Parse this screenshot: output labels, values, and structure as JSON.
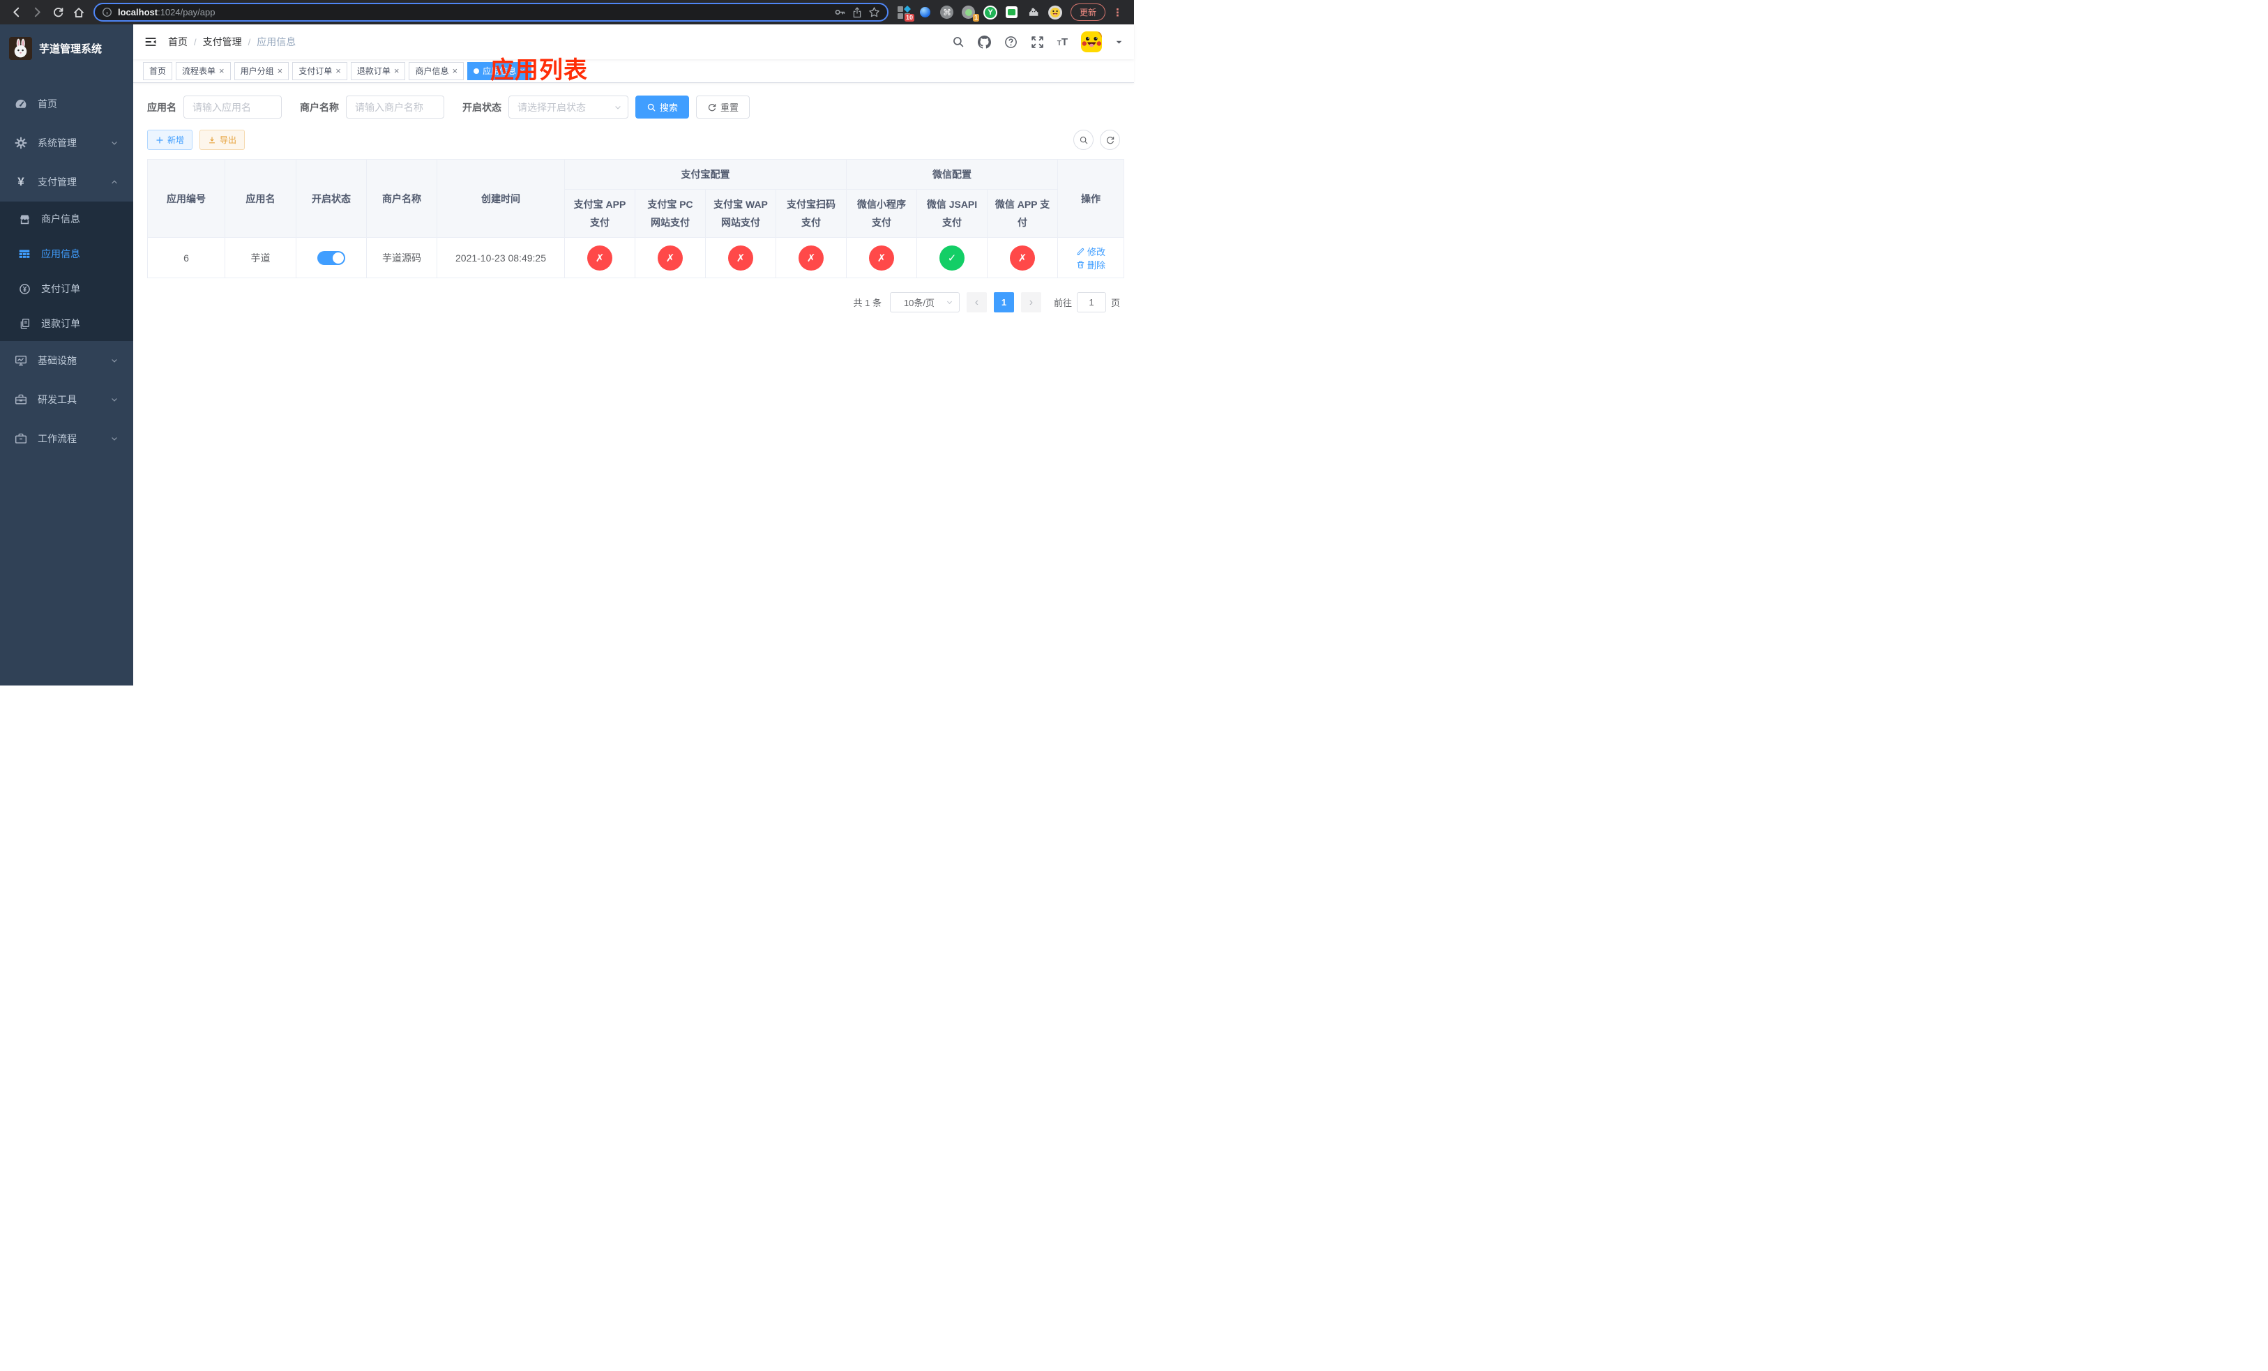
{
  "colors": {
    "accent": "#409eff",
    "success": "#13ce66",
    "danger": "#ff4949",
    "warning": "#e6a23c",
    "annotation_red": "#ff2e08",
    "sidebar_bg": "#304156",
    "submenu_bg": "#1f2d3d"
  },
  "icon_names": {
    "browser": [
      "back-icon",
      "forward-icon",
      "reload-icon",
      "home-icon",
      "info-icon",
      "key-icon",
      "share-icon",
      "star-icon",
      "sketch-extension-icon",
      "pin-extension-icon",
      "command-extension-icon",
      "recorder-extension-icon",
      "y-extension-icon",
      "chat-extension-icon",
      "puzzle-extensions-icon",
      "profile-face-icon",
      "menu-dots-icon"
    ],
    "navbar": [
      "hamburger-collapse-icon",
      "search-icon",
      "github-icon",
      "question-icon",
      "fullscreen-icon",
      "font-size-icon",
      "avatar",
      "caret-down-icon"
    ],
    "sidebar": [
      "dashboard-icon",
      "gear-icon",
      "yen-icon",
      "store-icon",
      "grid-icon",
      "yen-circle-icon",
      "documents-icon",
      "monitor-icon",
      "toolbox-icon",
      "briefcase-icon"
    ]
  },
  "browser": {
    "url_host": "localhost",
    "url_path": ":1024/pay/app",
    "ext_badge_sketch": "10",
    "ext_badge_recorder": "1",
    "ext_y_label": "Y",
    "update_label": "更新",
    "menu_dots": "⋮"
  },
  "sidebar": {
    "title": "芋道管理系统",
    "items": [
      {
        "label": "首页"
      },
      {
        "label": "系统管理"
      },
      {
        "label": "支付管理"
      },
      {
        "label": "基础设施"
      },
      {
        "label": "研发工具"
      },
      {
        "label": "工作流程"
      }
    ],
    "payment_children": [
      {
        "label": "商户信息"
      },
      {
        "label": "应用信息"
      },
      {
        "label": "支付订单"
      },
      {
        "label": "退款订单"
      }
    ]
  },
  "header": {
    "breadcrumb": [
      "首页",
      "支付管理",
      "应用信息"
    ],
    "annotation": "应用列表"
  },
  "tabs": [
    {
      "label": "首页"
    },
    {
      "label": "流程表单"
    },
    {
      "label": "用户分组"
    },
    {
      "label": "支付订单"
    },
    {
      "label": "退款订单"
    },
    {
      "label": "商户信息"
    },
    {
      "label": "应用信息"
    }
  ],
  "filters": {
    "app_name_label": "应用名",
    "app_name_placeholder": "请输入应用名",
    "merchant_label": "商户名称",
    "merchant_placeholder": "请输入商户名称",
    "status_label": "开启状态",
    "status_placeholder": "请选择开启状态",
    "search_label": "搜索",
    "reset_label": "重置"
  },
  "toolbar": {
    "add_label": "新增",
    "export_label": "导出"
  },
  "table": {
    "headers": {
      "app_id": "应用编号",
      "app_name": "应用名",
      "status": "开启状态",
      "merchant": "商户名称",
      "created": "创建时间",
      "alipay_group": "支付宝配置",
      "wechat_group": "微信配置",
      "alipay_cols": [
        "支付宝 APP 支付",
        "支付宝 PC 网站支付",
        "支付宝 WAP 网站支付",
        "支付宝扫码支付"
      ],
      "wechat_cols": [
        "微信小程序支付",
        "微信 JSAPI 支付",
        "微信 APP 支付"
      ],
      "ops": "操作"
    },
    "rows": [
      {
        "app_id": "6",
        "app_name": "芋道",
        "enabled": true,
        "merchant": "芋道源码",
        "created": "2021-10-23 08:49:25",
        "statuses": [
          "no",
          "no",
          "no",
          "no",
          "no",
          "yes",
          "no"
        ],
        "edit_label": "修改",
        "delete_label": "删除"
      }
    ]
  },
  "pagination": {
    "total": "共 1 条",
    "page_size": "10条/页",
    "current_page": "1",
    "goto_label": "前往",
    "goto_value": "1",
    "unit_label": "页"
  }
}
